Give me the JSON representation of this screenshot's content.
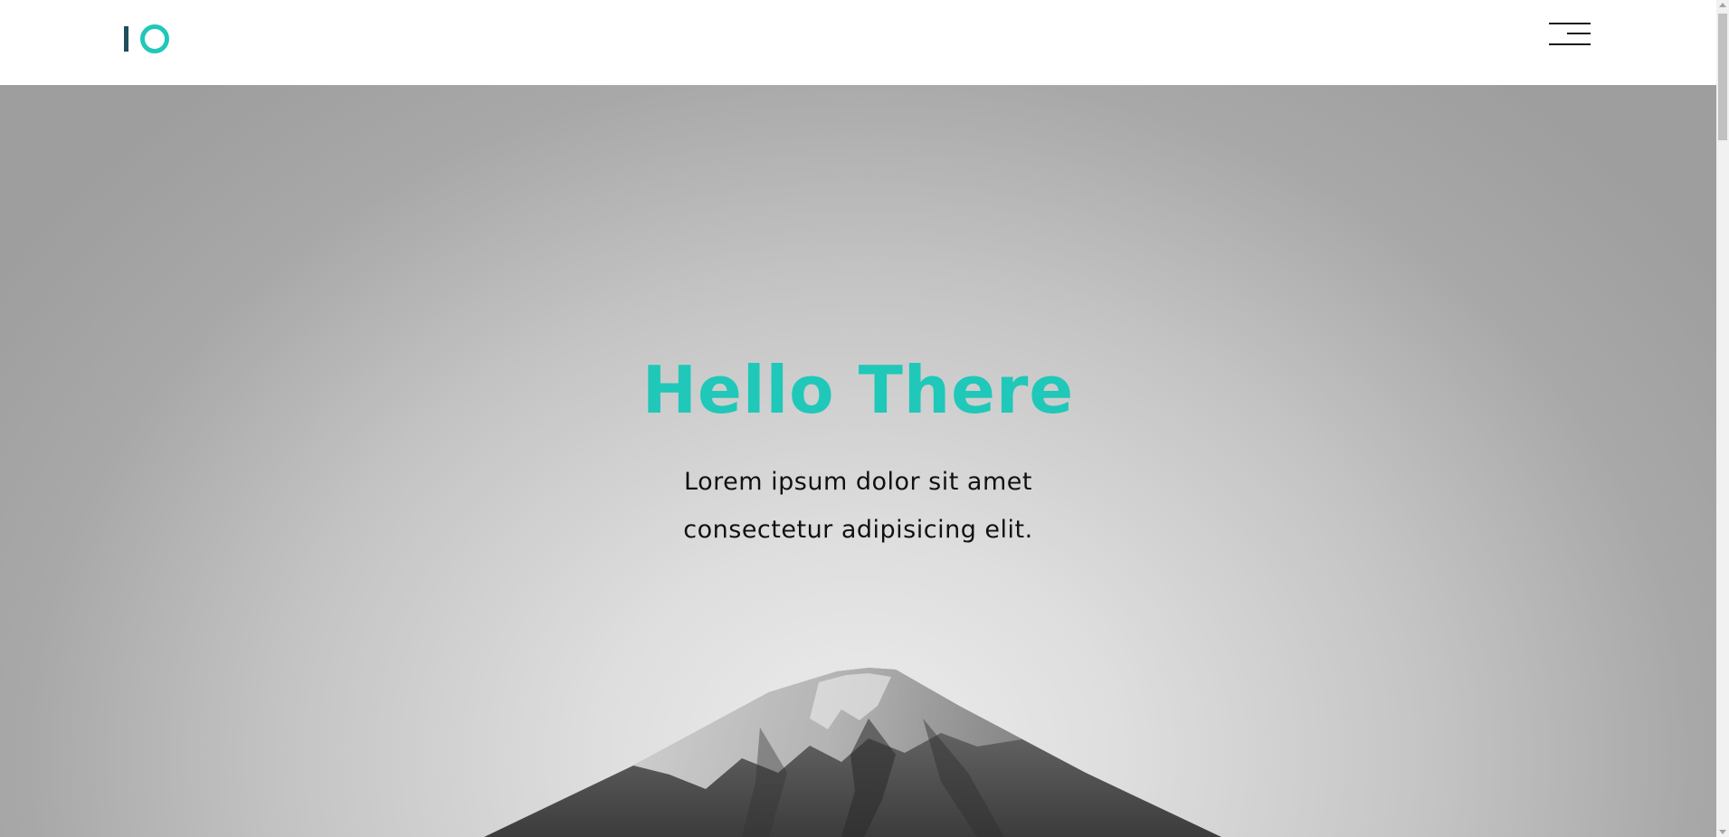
{
  "header": {
    "logo_icon": "io-logo-icon",
    "menu_icon": "hamburger-menu-icon"
  },
  "hero": {
    "title": "Hello There",
    "subtitle_line1": "Lorem ipsum dolor sit amet",
    "subtitle_line2": "consectetur adipisicing elit.",
    "background_image": "mountain-peak-image"
  },
  "colors": {
    "accent": "#1fc8b8",
    "logo_bar": "#1f4e5a",
    "text_dark": "#111111",
    "header_bg": "#ffffff"
  }
}
